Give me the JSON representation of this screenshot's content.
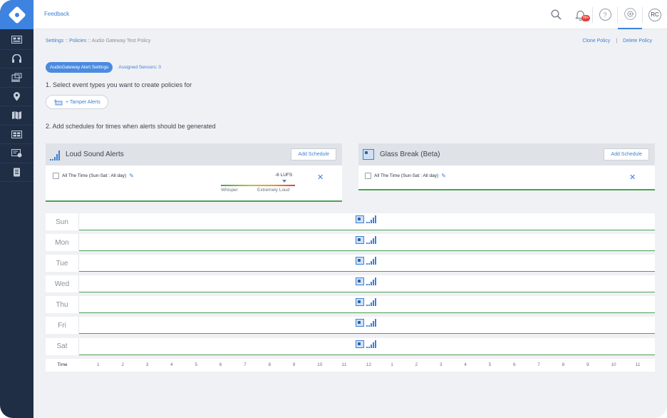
{
  "topbar": {
    "feedback": "Feedback",
    "notification_badge": "99+",
    "help": "?",
    "avatar": "RC"
  },
  "sidebar": {
    "items": [
      "dashboard-icon",
      "headset-icon",
      "devices-icon",
      "location-icon",
      "map-icon",
      "video-wall-icon",
      "policy-icon",
      "report-icon"
    ]
  },
  "breadcrumb": {
    "settings": "Settings",
    "sep1": " :: ",
    "policies": "Policies",
    "sep2": " :: ",
    "current": "Audio Gateway Test Policy"
  },
  "actions": {
    "clone": "Clone Policy",
    "divider": "|",
    "delete": "Delete Policy"
  },
  "tabs": {
    "active": "AudioGateway Alert Settings",
    "assigned": "Assigned Sensors: 0"
  },
  "steps": {
    "step1": "1. Select event types you want to create policies for",
    "tamper": "+ Tamper Alerts",
    "step2": "2. Add schedules for times when alerts should be generated"
  },
  "loud_card": {
    "title": "Loud Sound Alerts",
    "add_button": "Add Schedule",
    "schedule": "All The Time (Sun-Sat : All day)",
    "lufs": "-6 LUFS",
    "scale_low": "Whisper",
    "scale_high": "Extremely Loud",
    "close": "✕"
  },
  "glass_card": {
    "title": "Glass Break (Beta)",
    "add_button": "Add Schedule",
    "schedule": "All The Time (Sun-Sat : All day)",
    "close": "✕"
  },
  "timeline": {
    "days": [
      "Sun",
      "Mon",
      "Tue",
      "Wed",
      "Thu",
      "Fri",
      "Sat"
    ],
    "time_label": "Time",
    "hours": [
      "1",
      "2",
      "3",
      "4",
      "5",
      "6",
      "7",
      "8",
      "9",
      "10",
      "11",
      "12",
      "1",
      "2",
      "3",
      "4",
      "5",
      "6",
      "7",
      "8",
      "9",
      "10",
      "11"
    ]
  },
  "colors": {
    "accent": "#3d83df",
    "sidebar": "#1f2d45",
    "schedule_line": "#4aa252",
    "badge": "#e2403b"
  }
}
